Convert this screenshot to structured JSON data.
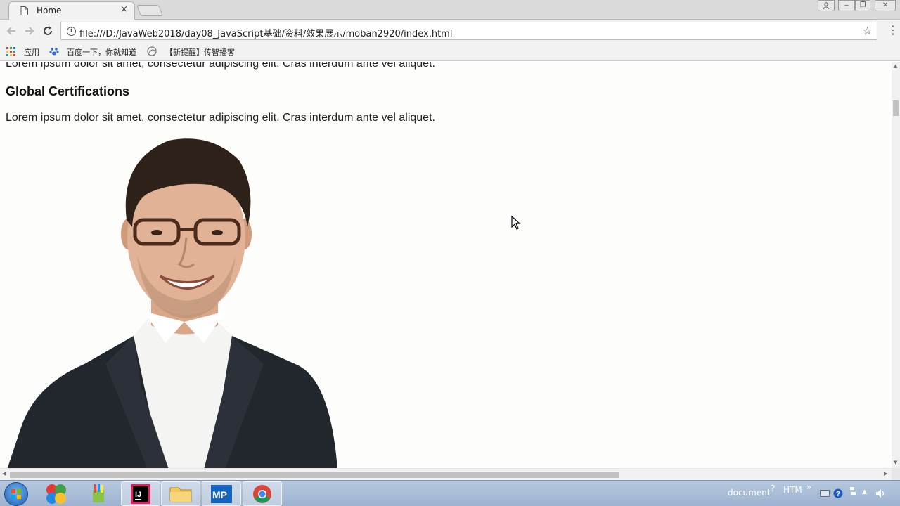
{
  "browser": {
    "tab_title": "Home",
    "tab_close": "×",
    "url": "file:///D:/JavaWeb2018/day08_JavaScript基础/资料/效果展示/moban2920/index.html",
    "back_icon": "arrow-left-icon",
    "forward_icon": "arrow-right-icon",
    "reload_icon": "reload-icon",
    "info_icon_glyph": "i",
    "star_glyph": "☆",
    "menu_glyph": "⋮"
  },
  "bookmarks": {
    "items": [
      "应用",
      "百度一下，你就知道",
      "【新提醒】传智播客"
    ]
  },
  "page": {
    "para_top": "Lorem ipsum dolor sit amet, consectetur adipiscing elit. Cras interdum ante vel aliquet.",
    "heading": "Global Certifications",
    "para_body": "Lorem ipsum dolor sit amet, consectetur adipiscing elit. Cras interdum ante vel aliquet."
  },
  "taskbar": {
    "tray_document": "document",
    "tray_htm": "HTM",
    "tray_more": "»",
    "app_mp": "MP",
    "app_ij": "IJ"
  }
}
